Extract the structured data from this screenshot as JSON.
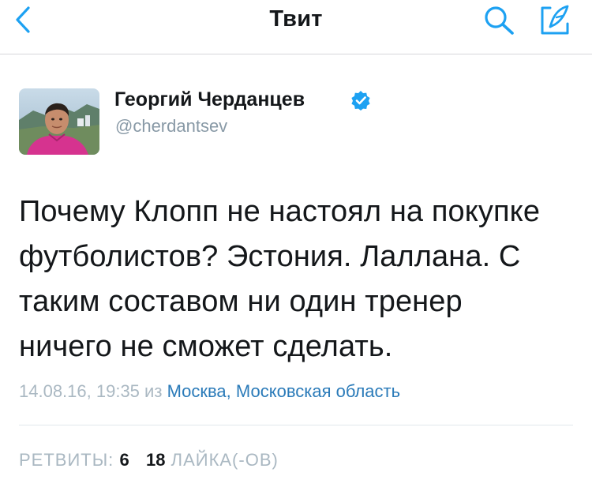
{
  "nav": {
    "title": "Твит",
    "back_icon": "chevron-left-icon",
    "search_icon": "search-icon",
    "compose_icon": "compose-icon",
    "accent": "#1da1f2"
  },
  "author": {
    "name": "Георгий Черданцев",
    "handle": "@cherdantsev",
    "verified": true
  },
  "tweet": {
    "lines": [
      "Почему Клопп не настоял на покупке",
      "футболистов? Эстония. Лаллана. С",
      "таким составом ни один тренер",
      "ничего не сможет сделать."
    ]
  },
  "meta": {
    "timestamp": "14.08.16, 19:35",
    "from_word": "из",
    "location": "Москва, Московская область"
  },
  "stats": {
    "retweets_label": "РЕТВИТЫ:",
    "retweets_count": "6",
    "likes_count": "18",
    "likes_label": "ЛАЙКА(-ОВ)"
  }
}
